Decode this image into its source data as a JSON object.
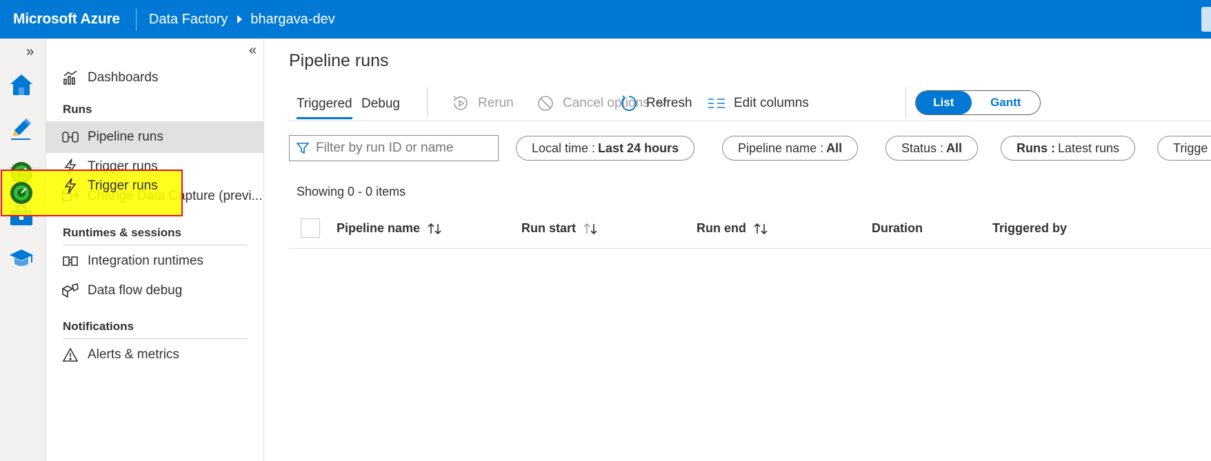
{
  "topbar": {
    "brand": "Microsoft Azure",
    "breadcrumb": [
      "Data Factory",
      "bhargava-dev"
    ]
  },
  "rail": {
    "expand_icon": "double-chevron-right-icon",
    "items": [
      {
        "name": "home-icon"
      },
      {
        "name": "author-pencil-icon"
      },
      {
        "name": "monitor-gauge-icon",
        "active": true
      },
      {
        "name": "manage-toolbox-icon"
      },
      {
        "name": "learning-center-icon"
      }
    ]
  },
  "sidebar": {
    "collapse_icon": "double-chevron-left-icon",
    "dashboards": "Dashboards",
    "sections": {
      "runs": "Runs",
      "runtimes": "Runtimes & sessions",
      "notifications": "Notifications"
    },
    "items": {
      "pipeline_runs": "Pipeline runs",
      "trigger_runs": "Trigger runs",
      "cdc": "Change Data Capture (previ...",
      "integration_runtimes": "Integration runtimes",
      "data_flow_debug": "Data flow debug",
      "alerts": "Alerts & metrics"
    }
  },
  "main": {
    "title": "Pipeline runs",
    "tabs": [
      "Triggered",
      "Debug"
    ],
    "toolbar": {
      "rerun": "Rerun",
      "cancel": "Cancel options",
      "refresh": "Refresh",
      "edit_columns": "Edit columns"
    },
    "view_toggle": {
      "list": "List",
      "gantt": "Gantt",
      "selected": "List"
    },
    "filter": {
      "placeholder": "Filter by run ID or name"
    },
    "pills": [
      {
        "label": "Local time :",
        "value": "Last 24 hours"
      },
      {
        "label": "Pipeline name :",
        "value": "All"
      },
      {
        "label": "Status :",
        "value": "All"
      },
      {
        "label": "Runs :",
        "value": "Latest runs"
      },
      {
        "label": "Trigge",
        "value": ""
      }
    ],
    "showing": "Showing 0 - 0 items",
    "columns": [
      "Pipeline name",
      "Run start",
      "Run end",
      "Duration",
      "Triggered by"
    ]
  },
  "colors": {
    "accent": "#0078d4",
    "highlight": "#ffff00",
    "highlight_border": "#e81123"
  }
}
